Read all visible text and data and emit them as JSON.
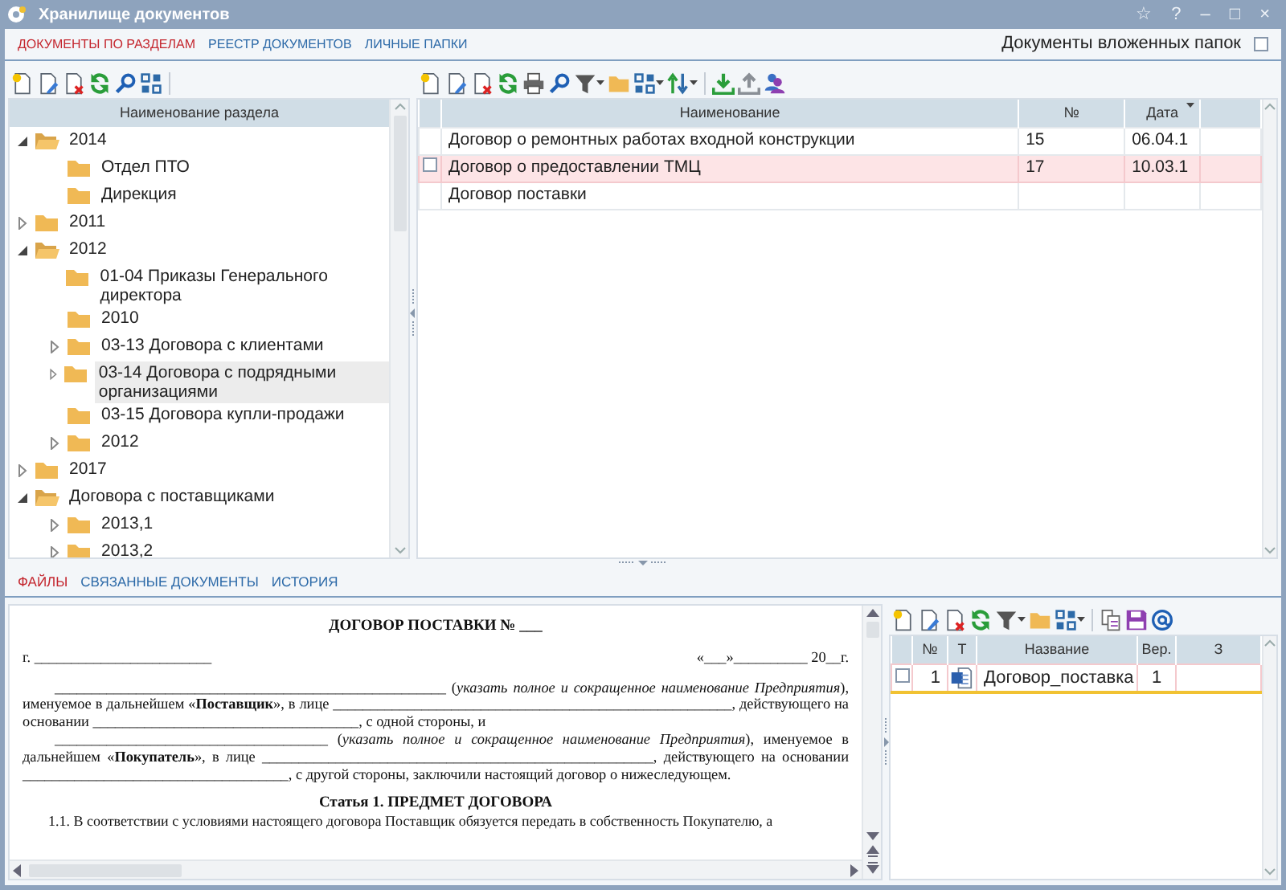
{
  "window": {
    "title": "Хранилище документов",
    "buttons": [
      "☆",
      "?",
      "–",
      "□",
      "×"
    ]
  },
  "tabs": [
    {
      "label": "ДОКУМЕНТЫ ПО РАЗДЕЛАМ",
      "selected": true
    },
    {
      "label": "РЕЕСТР ДОКУМЕНТОВ",
      "selected": false
    },
    {
      "label": "ЛИЧНЫЕ ПАПКИ",
      "selected": false
    }
  ],
  "nested_folders": {
    "label": "Документы вложенных папок",
    "checked": false
  },
  "sections": {
    "column": "Наименование раздела",
    "tree": [
      {
        "label": "2014",
        "kind": "open",
        "selected": false,
        "children": [
          {
            "label": "Отдел ПТО",
            "kind": "leaf",
            "selected": false
          },
          {
            "label": "Дирекция",
            "kind": "leaf",
            "selected": false
          }
        ]
      },
      {
        "label": "2011",
        "kind": "closed",
        "selected": false
      },
      {
        "label": "2012",
        "kind": "open",
        "selected": false,
        "children": [
          {
            "label": "01-04 Приказы Генерального директора",
            "kind": "leaf",
            "selected": false
          },
          {
            "label": "2010",
            "kind": "leaf",
            "selected": false
          },
          {
            "label": "03-13 Договора с клиентами",
            "kind": "closed",
            "selected": false
          },
          {
            "label": "03-14 Договора с подрядными организациями",
            "kind": "closed",
            "selected": true
          },
          {
            "label": "03-15 Договора купли-продажи",
            "kind": "leaf",
            "selected": false
          },
          {
            "label": "2012",
            "kind": "closed",
            "selected": false
          }
        ]
      },
      {
        "label": "2017",
        "kind": "closed",
        "selected": false
      },
      {
        "label": "Договора с поставщиками",
        "kind": "open",
        "selected": false,
        "children": [
          {
            "label": "2013,1",
            "kind": "closed",
            "selected": false
          },
          {
            "label": "2013,2",
            "kind": "closed",
            "selected": false
          }
        ]
      }
    ]
  },
  "documents": {
    "columns": [
      {
        "label": "Наименование",
        "sorted": false
      },
      {
        "label": "№",
        "sorted": false
      },
      {
        "label": "Дата",
        "sorted": true
      }
    ],
    "rows": [
      {
        "name": "Договор о ремонтных работах входной конструкции",
        "number": "15",
        "date": "06.04.1",
        "selected": false
      },
      {
        "name": "Договор о предоставлении ТМЦ",
        "number": "17",
        "date": "10.03.1",
        "selected": true
      },
      {
        "name": "Договор поставки",
        "number": "",
        "date": "",
        "selected": false
      }
    ]
  },
  "detail_tabs": [
    {
      "label": "ФАЙЛЫ",
      "selected": true
    },
    {
      "label": "СВЯЗАННЫЕ ДОКУМЕНТЫ",
      "selected": false
    },
    {
      "label": "ИСТОРИЯ",
      "selected": false
    }
  ],
  "preview": {
    "title": "ДОГОВОР ПОСТАВКИ № ___",
    "place": "г. ________________________",
    "date": "«___»__________ 20__г.",
    "paragraphs": [
      "_____________________________________________________ (*указать полное и сокращенное наименование Предприятия*), именуемое в дальнейшем «**Поставщик**», в лице ______________________________________________________, действующего на основании ____________________________________, с одной стороны, и",
      "_____________________________________ (*указать полное и сокращенное наименование Предприятия*), именуемое в дальнейшем «**Покупатель**», в лице _____________________________________________________, действующего на основании ____________________________________, с другой стороны, заключили настоящий договор о нижеследующем."
    ],
    "heading": "Статья 1. ПРЕДМЕТ ДОГОВОРА",
    "clause": "1.1. В соответствии с условиями настоящего договора Поставщик обязуется передать в собственность Покупателю, а"
  },
  "files": {
    "columns": [
      "№",
      "Т",
      "Название",
      "Вер.",
      "З"
    ],
    "rows": [
      {
        "number": "1",
        "kind": "word",
        "name": "Договор_поставка",
        "version": "1",
        "checked": false,
        "selected": true
      }
    ]
  }
}
